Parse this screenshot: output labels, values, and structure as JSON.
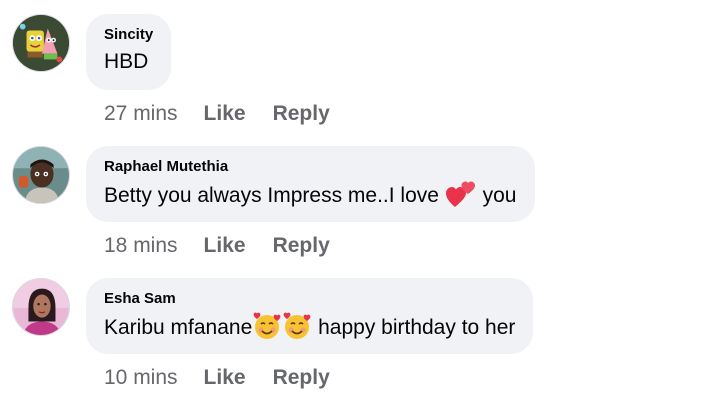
{
  "comments": [
    {
      "author": "Sincity",
      "text_parts": [
        "HBD"
      ],
      "time": "27 mins",
      "like_label": "Like",
      "reply_label": "Reply",
      "avatar_icon": "cartoon-avatar"
    },
    {
      "author": "Raphael Mutethia",
      "text_parts": [
        "Betty you always Impress me..I love ",
        " you"
      ],
      "emoji": [
        "two-hearts-icon"
      ],
      "time": "18 mins",
      "like_label": "Like",
      "reply_label": "Reply",
      "avatar_icon": "person-avatar"
    },
    {
      "author": "Esha Sam",
      "text_parts": [
        "Karibu mfanane",
        " happy birthday to her"
      ],
      "emoji": [
        "smiling-face-with-hearts-icon",
        "smiling-face-with-hearts-icon"
      ],
      "time": "10 mins",
      "like_label": "Like",
      "reply_label": "Reply",
      "avatar_icon": "person-avatar"
    }
  ],
  "colors": {
    "bubble": "#f0f2f5",
    "meta_text": "#65676b",
    "text": "#050505"
  }
}
